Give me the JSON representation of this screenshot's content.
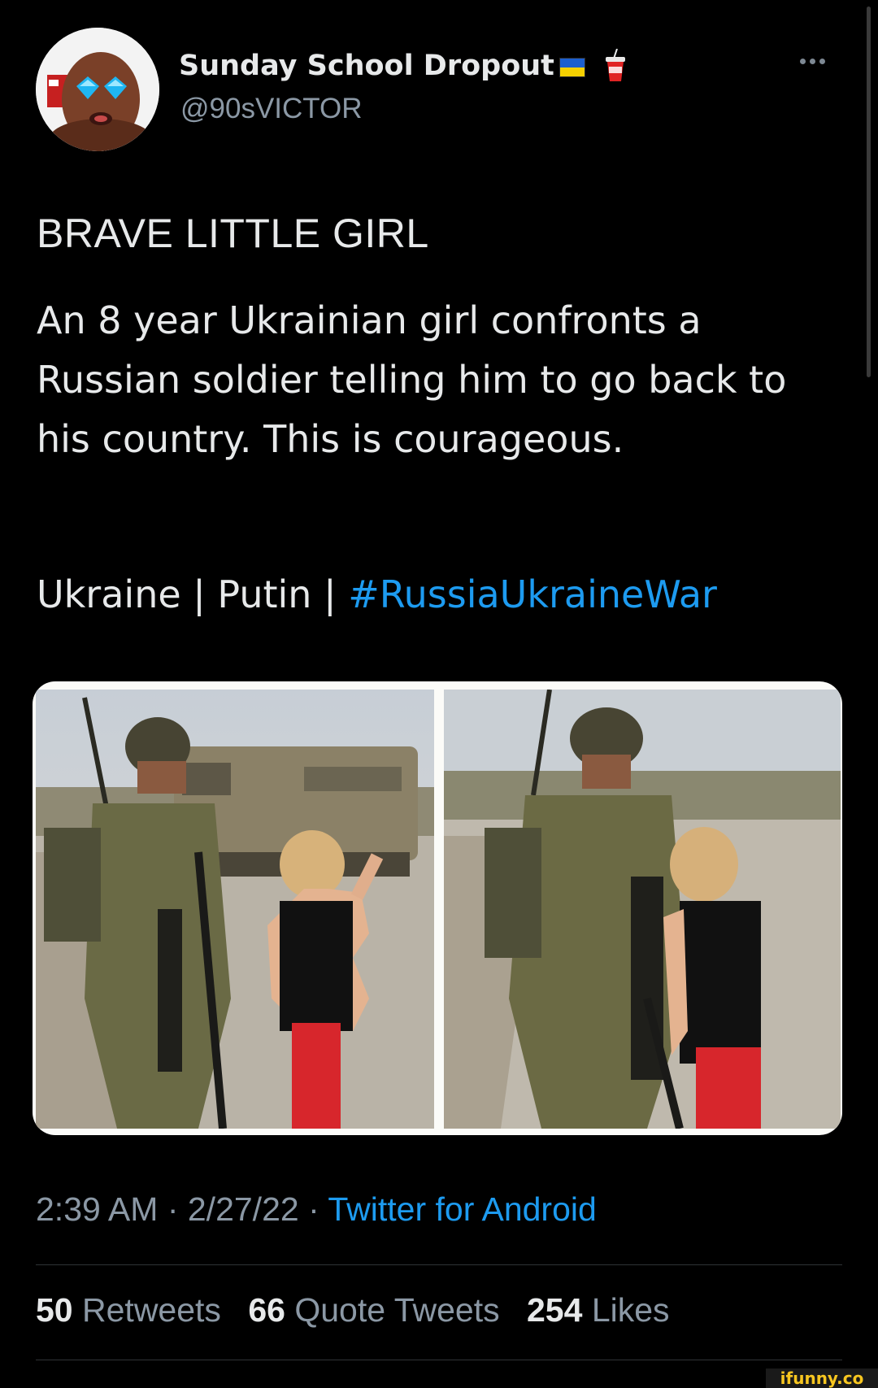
{
  "tweet": {
    "author": {
      "display_name": "Sunday School Dropout",
      "handle": "@90sVICTOR",
      "emoji_icons": [
        "ukraine-flag-icon",
        "cup-with-straw-icon"
      ]
    },
    "headline": "BRAVE LITTLE GIRL",
    "body": "An 8 year Ukrainian girl confronts a Russian soldier telling him to go back to his country. This is courageous.",
    "tags_line": {
      "prefix": "Ukraine | Putin | ",
      "hashtag": "#RussiaUkraineWar"
    },
    "media": {
      "count": 2,
      "images": [
        "photo-soldier-and-girl-1",
        "photo-soldier-and-girl-2"
      ]
    },
    "meta": {
      "time": "2:39 AM",
      "separator": " · ",
      "date": "2/27/22",
      "source": "Twitter for Android"
    },
    "stats": {
      "retweets_count": "50",
      "retweets_label": "Retweets",
      "quotes_count": "66",
      "quotes_label": "Quote Tweets",
      "likes_count": "254",
      "likes_label": "Likes"
    }
  },
  "watermark": "ifunny.co",
  "colors": {
    "background": "#000000",
    "text": "#e7e9ea",
    "secondary": "#8b98a5",
    "link": "#1d9bf0"
  }
}
